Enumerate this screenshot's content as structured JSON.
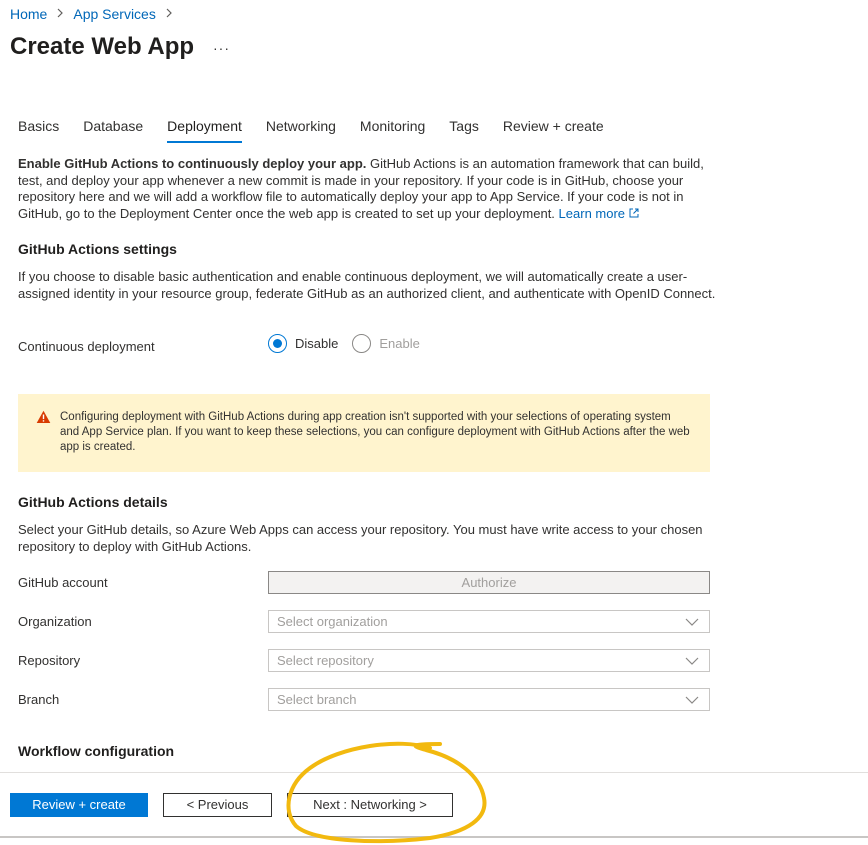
{
  "breadcrumb": {
    "home": "Home",
    "app_services": "App Services"
  },
  "page": {
    "title": "Create Web App",
    "more": "···"
  },
  "tabs": [
    {
      "label": "Basics",
      "active": false
    },
    {
      "label": "Database",
      "active": false
    },
    {
      "label": "Deployment",
      "active": true
    },
    {
      "label": "Networking",
      "active": false
    },
    {
      "label": "Monitoring",
      "active": false
    },
    {
      "label": "Tags",
      "active": false
    },
    {
      "label": "Review + create",
      "active": false
    }
  ],
  "intro": {
    "bold": "Enable GitHub Actions to continuously deploy your app.",
    "text": " GitHub Actions is an automation framework that can build, test, and deploy your app whenever a new commit is made in your repository. If your code is in GitHub, choose your repository here and we will add a workflow file to automatically deploy your app to App Service. If your code is not in GitHub, go to the Deployment Center once the web app is created to set up your deployment. ",
    "link": "Learn more"
  },
  "settings": {
    "title": "GitHub Actions settings",
    "description": "If you choose to disable basic authentication and enable continuous deployment, we will automatically create a user-assigned identity in your resource group, federate GitHub as an authorized client, and authenticate with OpenID Connect.",
    "cd_label": "Continuous deployment",
    "option_disable": "Disable",
    "option_enable": "Enable",
    "selected": "Disable"
  },
  "warning": {
    "text": "Configuring deployment with GitHub Actions during app creation isn't supported with your selections of operating system and App Service plan. If you want to keep these selections, you can configure deployment with GitHub Actions after the web app is created.",
    "color": "#fff4ce",
    "icon_color": "#d83b01"
  },
  "details": {
    "title": "GitHub Actions details",
    "description": "Select your GitHub details, so Azure Web Apps can access your repository. You must have write access to your chosen repository to deploy with GitHub Actions.",
    "account_label": "GitHub account",
    "authorize": "Authorize",
    "org_label": "Organization",
    "org_placeholder": "Select organization",
    "repo_label": "Repository",
    "repo_placeholder": "Select repository",
    "branch_label": "Branch",
    "branch_placeholder": "Select branch"
  },
  "workflow": {
    "title": "Workflow configuration"
  },
  "footer": {
    "review_create": "Review + create",
    "previous": "< Previous",
    "next": "Next : Networking >"
  },
  "colors": {
    "accent": "#0078d4",
    "link": "#0067b8",
    "annotation": "#f2b90f"
  }
}
